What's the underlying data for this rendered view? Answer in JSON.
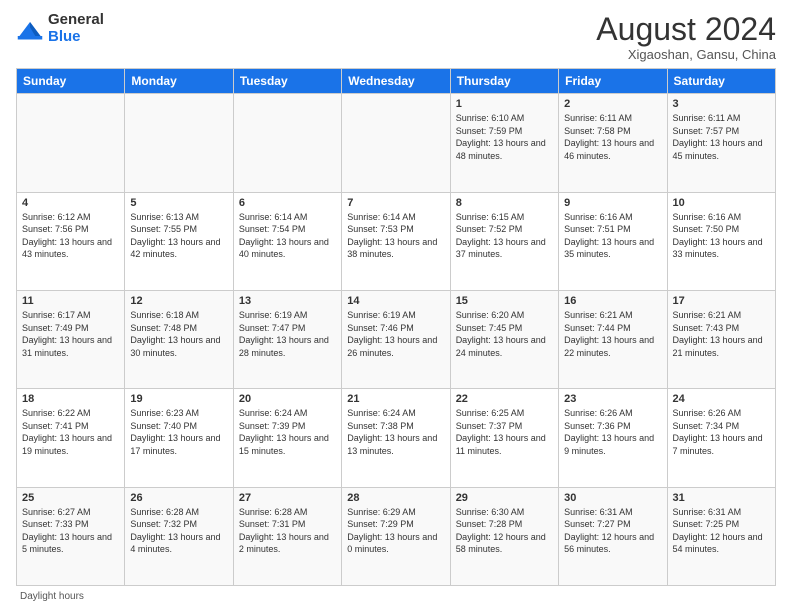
{
  "logo": {
    "general": "General",
    "blue": "Blue"
  },
  "title": "August 2024",
  "subtitle": "Xigaoshan, Gansu, China",
  "days_of_week": [
    "Sunday",
    "Monday",
    "Tuesday",
    "Wednesday",
    "Thursday",
    "Friday",
    "Saturday"
  ],
  "weeks": [
    [
      {
        "day": "",
        "info": ""
      },
      {
        "day": "",
        "info": ""
      },
      {
        "day": "",
        "info": ""
      },
      {
        "day": "",
        "info": ""
      },
      {
        "day": "1",
        "info": "Sunrise: 6:10 AM\nSunset: 7:59 PM\nDaylight: 13 hours\nand 48 minutes."
      },
      {
        "day": "2",
        "info": "Sunrise: 6:11 AM\nSunset: 7:58 PM\nDaylight: 13 hours\nand 46 minutes."
      },
      {
        "day": "3",
        "info": "Sunrise: 6:11 AM\nSunset: 7:57 PM\nDaylight: 13 hours\nand 45 minutes."
      }
    ],
    [
      {
        "day": "4",
        "info": "Sunrise: 6:12 AM\nSunset: 7:56 PM\nDaylight: 13 hours\nand 43 minutes."
      },
      {
        "day": "5",
        "info": "Sunrise: 6:13 AM\nSunset: 7:55 PM\nDaylight: 13 hours\nand 42 minutes."
      },
      {
        "day": "6",
        "info": "Sunrise: 6:14 AM\nSunset: 7:54 PM\nDaylight: 13 hours\nand 40 minutes."
      },
      {
        "day": "7",
        "info": "Sunrise: 6:14 AM\nSunset: 7:53 PM\nDaylight: 13 hours\nand 38 minutes."
      },
      {
        "day": "8",
        "info": "Sunrise: 6:15 AM\nSunset: 7:52 PM\nDaylight: 13 hours\nand 37 minutes."
      },
      {
        "day": "9",
        "info": "Sunrise: 6:16 AM\nSunset: 7:51 PM\nDaylight: 13 hours\nand 35 minutes."
      },
      {
        "day": "10",
        "info": "Sunrise: 6:16 AM\nSunset: 7:50 PM\nDaylight: 13 hours\nand 33 minutes."
      }
    ],
    [
      {
        "day": "11",
        "info": "Sunrise: 6:17 AM\nSunset: 7:49 PM\nDaylight: 13 hours\nand 31 minutes."
      },
      {
        "day": "12",
        "info": "Sunrise: 6:18 AM\nSunset: 7:48 PM\nDaylight: 13 hours\nand 30 minutes."
      },
      {
        "day": "13",
        "info": "Sunrise: 6:19 AM\nSunset: 7:47 PM\nDaylight: 13 hours\nand 28 minutes."
      },
      {
        "day": "14",
        "info": "Sunrise: 6:19 AM\nSunset: 7:46 PM\nDaylight: 13 hours\nand 26 minutes."
      },
      {
        "day": "15",
        "info": "Sunrise: 6:20 AM\nSunset: 7:45 PM\nDaylight: 13 hours\nand 24 minutes."
      },
      {
        "day": "16",
        "info": "Sunrise: 6:21 AM\nSunset: 7:44 PM\nDaylight: 13 hours\nand 22 minutes."
      },
      {
        "day": "17",
        "info": "Sunrise: 6:21 AM\nSunset: 7:43 PM\nDaylight: 13 hours\nand 21 minutes."
      }
    ],
    [
      {
        "day": "18",
        "info": "Sunrise: 6:22 AM\nSunset: 7:41 PM\nDaylight: 13 hours\nand 19 minutes."
      },
      {
        "day": "19",
        "info": "Sunrise: 6:23 AM\nSunset: 7:40 PM\nDaylight: 13 hours\nand 17 minutes."
      },
      {
        "day": "20",
        "info": "Sunrise: 6:24 AM\nSunset: 7:39 PM\nDaylight: 13 hours\nand 15 minutes."
      },
      {
        "day": "21",
        "info": "Sunrise: 6:24 AM\nSunset: 7:38 PM\nDaylight: 13 hours\nand 13 minutes."
      },
      {
        "day": "22",
        "info": "Sunrise: 6:25 AM\nSunset: 7:37 PM\nDaylight: 13 hours\nand 11 minutes."
      },
      {
        "day": "23",
        "info": "Sunrise: 6:26 AM\nSunset: 7:36 PM\nDaylight: 13 hours\nand 9 minutes."
      },
      {
        "day": "24",
        "info": "Sunrise: 6:26 AM\nSunset: 7:34 PM\nDaylight: 13 hours\nand 7 minutes."
      }
    ],
    [
      {
        "day": "25",
        "info": "Sunrise: 6:27 AM\nSunset: 7:33 PM\nDaylight: 13 hours\nand 5 minutes."
      },
      {
        "day": "26",
        "info": "Sunrise: 6:28 AM\nSunset: 7:32 PM\nDaylight: 13 hours\nand 4 minutes."
      },
      {
        "day": "27",
        "info": "Sunrise: 6:28 AM\nSunset: 7:31 PM\nDaylight: 13 hours\nand 2 minutes."
      },
      {
        "day": "28",
        "info": "Sunrise: 6:29 AM\nSunset: 7:29 PM\nDaylight: 13 hours\nand 0 minutes."
      },
      {
        "day": "29",
        "info": "Sunrise: 6:30 AM\nSunset: 7:28 PM\nDaylight: 12 hours\nand 58 minutes."
      },
      {
        "day": "30",
        "info": "Sunrise: 6:31 AM\nSunset: 7:27 PM\nDaylight: 12 hours\nand 56 minutes."
      },
      {
        "day": "31",
        "info": "Sunrise: 6:31 AM\nSunset: 7:25 PM\nDaylight: 12 hours\nand 54 minutes."
      }
    ]
  ],
  "footer": "Daylight hours"
}
